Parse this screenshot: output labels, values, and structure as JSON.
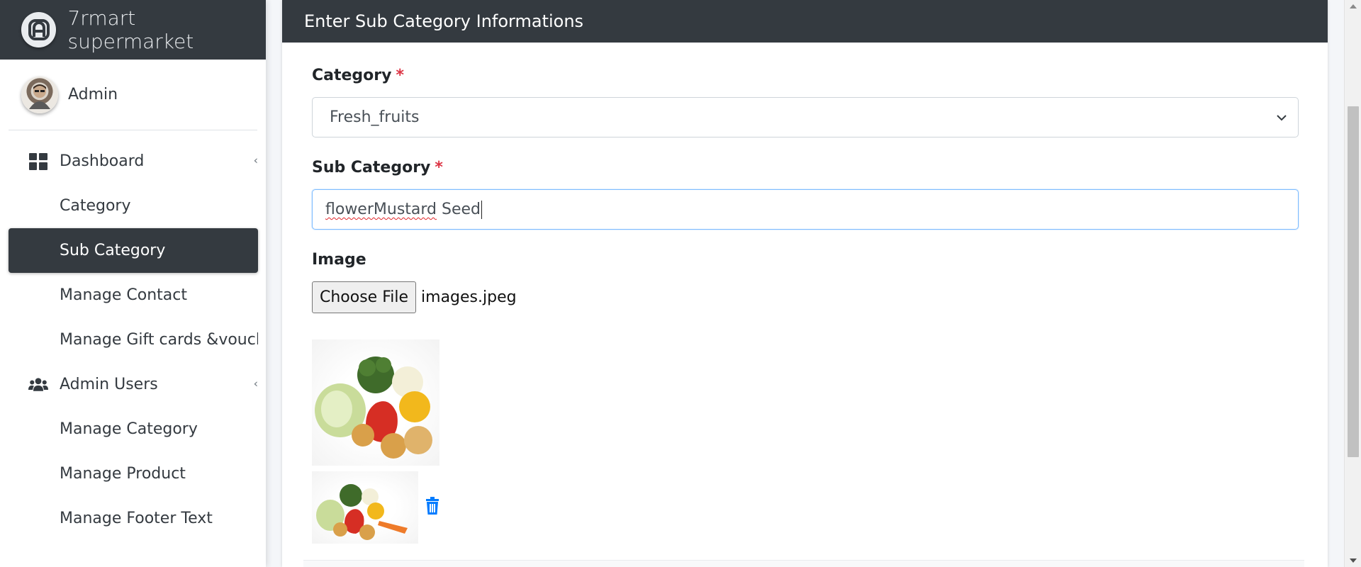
{
  "sidebar": {
    "brand": "7rmart supermarket",
    "user": "Admin",
    "items": [
      {
        "label": "Dashboard",
        "icon": "dashboard-icon"
      },
      {
        "label": "Category"
      },
      {
        "label": "Sub Category",
        "active": true
      },
      {
        "label": "Manage Contact"
      },
      {
        "label": "Manage Gift cards &voucher"
      },
      {
        "label": "Admin Users",
        "icon": "users-icon"
      },
      {
        "label": "Manage Category"
      },
      {
        "label": "Manage Product"
      },
      {
        "label": "Manage Footer Text"
      }
    ]
  },
  "form": {
    "title": "Enter Sub Category Informations",
    "category_label": "Category",
    "category_value": "Fresh_fruits",
    "subcategory_label": "Sub Category",
    "subcategory_value_misspelled": "flowerMustard",
    "subcategory_value_rest": " Seed",
    "required_mark": "*",
    "image_label": "Image",
    "choose_file": "Choose File",
    "file_name": "images.jpeg"
  },
  "colors": {
    "sidebar_dark": "#343a40",
    "required": "#dc3545",
    "delete_icon": "#007bff"
  }
}
